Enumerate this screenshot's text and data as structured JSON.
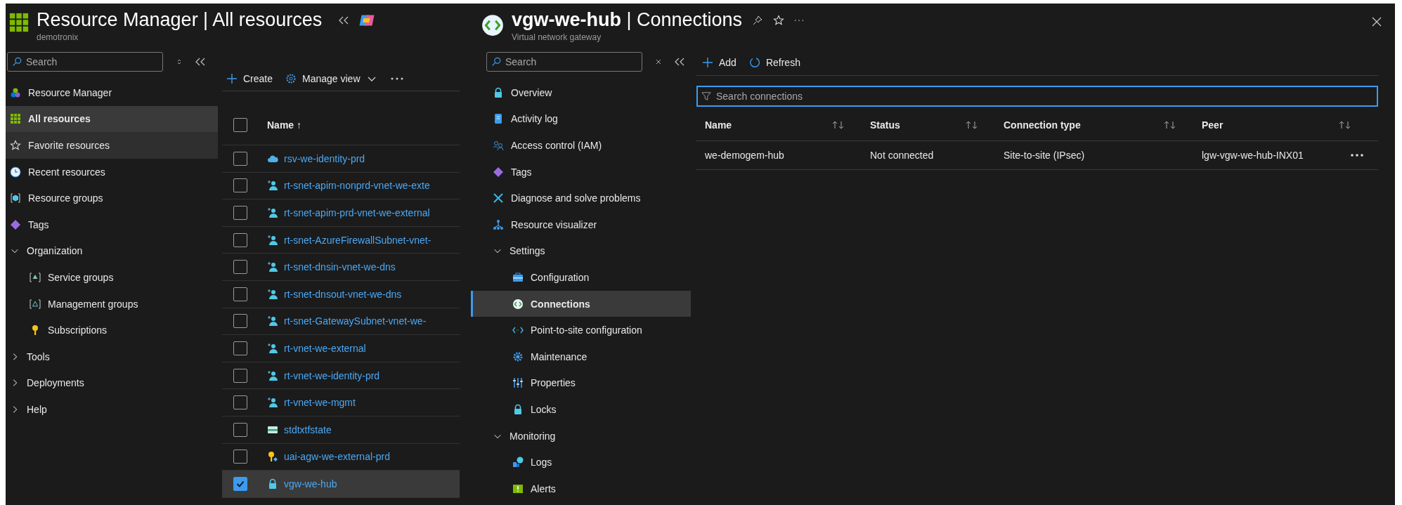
{
  "left_blade": {
    "title": "Resource Manager | All resources",
    "subtitle": "demotronix",
    "sidebar": {
      "search": {
        "placeholder": "Search"
      },
      "items": [
        {
          "label": "Resource Manager",
          "selected": false,
          "hovered": false
        },
        {
          "label": "All resources",
          "selected": true,
          "hovered": false
        },
        {
          "label": "Favorite resources",
          "selected": false,
          "hovered": true
        },
        {
          "label": "Recent resources",
          "selected": false,
          "hovered": false
        },
        {
          "label": "Resource groups",
          "selected": false,
          "hovered": false
        },
        {
          "label": "Tags",
          "selected": false,
          "hovered": false
        },
        {
          "label": "Organization",
          "selected": false,
          "hovered": false,
          "expanded": true,
          "children": [
            {
              "label": "Service groups",
              "selected": false,
              "hovered": false
            },
            {
              "label": "Management groups",
              "selected": false,
              "hovered": false
            },
            {
              "label": "Subscriptions",
              "selected": false,
              "hovered": false
            }
          ]
        },
        {
          "label": "Tools",
          "selected": false,
          "hovered": false,
          "expanded": false
        },
        {
          "label": "Deployments",
          "selected": false,
          "hovered": false,
          "expanded": false
        },
        {
          "label": "Help",
          "selected": false,
          "hovered": false,
          "expanded": false
        }
      ]
    },
    "toolbar": [
      "Create",
      "Manage view"
    ],
    "select_all": {
      "checked": false
    },
    "table": {
      "columns": [
        "Name ↑"
      ],
      "rows": [
        {
          "name": "rsv-we-identity-prd",
          "checked": false
        },
        {
          "name": "rt-snet-apim-nonprd-vnet-we-exte",
          "checked": false
        },
        {
          "name": "rt-snet-apim-prd-vnet-we-external",
          "checked": false
        },
        {
          "name": "rt-snet-AzureFirewallSubnet-vnet-",
          "checked": false
        },
        {
          "name": "rt-snet-dnsin-vnet-we-dns",
          "checked": false
        },
        {
          "name": "rt-snet-dnsout-vnet-we-dns",
          "checked": false
        },
        {
          "name": "rt-snet-GatewaySubnet-vnet-we-",
          "checked": false
        },
        {
          "name": "rt-vnet-we-external",
          "checked": false
        },
        {
          "name": "rt-vnet-we-identity-prd",
          "checked": false
        },
        {
          "name": "rt-vnet-we-mgmt",
          "checked": false
        },
        {
          "name": "stdtxtfstate",
          "checked": false
        },
        {
          "name": "uai-agw-we-external-prd",
          "checked": false
        },
        {
          "name": "vgw-we-hub",
          "checked": true
        }
      ]
    }
  },
  "right_blade": {
    "title": "**vgw-we-hub** | Connections",
    "subtitle": "Virtual network gateway",
    "nav": {
      "search": {
        "placeholder": "Search"
      },
      "items": [
        {
          "label": "Overview",
          "selected": false
        },
        {
          "label": "Activity log",
          "selected": false
        },
        {
          "label": "Access control (IAM)",
          "selected": false
        },
        {
          "label": "Tags",
          "selected": false
        },
        {
          "label": "Diagnose and solve problems",
          "selected": false
        },
        {
          "label": "Resource visualizer",
          "selected": false
        },
        {
          "label": "Settings",
          "selected": false,
          "expanded": true,
          "children": [
            {
              "label": "Configuration",
              "selected": false
            },
            {
              "label": "Connections",
              "selected": true
            },
            {
              "label": "Point-to-site configuration",
              "selected": false
            },
            {
              "label": "Maintenance",
              "selected": false
            },
            {
              "label": "Properties",
              "selected": false
            },
            {
              "label": "Locks",
              "selected": false
            }
          ]
        },
        {
          "label": "Monitoring",
          "selected": false,
          "expanded": true,
          "children": [
            {
              "label": "Logs",
              "selected": false
            },
            {
              "label": "Alerts",
              "selected": false
            }
          ]
        }
      ]
    },
    "toolbar": [
      "Add",
      "Refresh"
    ],
    "filter": {
      "placeholder": "Search connections"
    },
    "table": {
      "columns": [
        "Name",
        "Status",
        "Connection type",
        "Peer"
      ],
      "rows": [
        [
          "we-demogem-hub",
          "Not connected",
          "Site-to-site (IPsec)",
          "lgw-vgw-we-hub-INX01"
        ]
      ]
    }
  }
}
